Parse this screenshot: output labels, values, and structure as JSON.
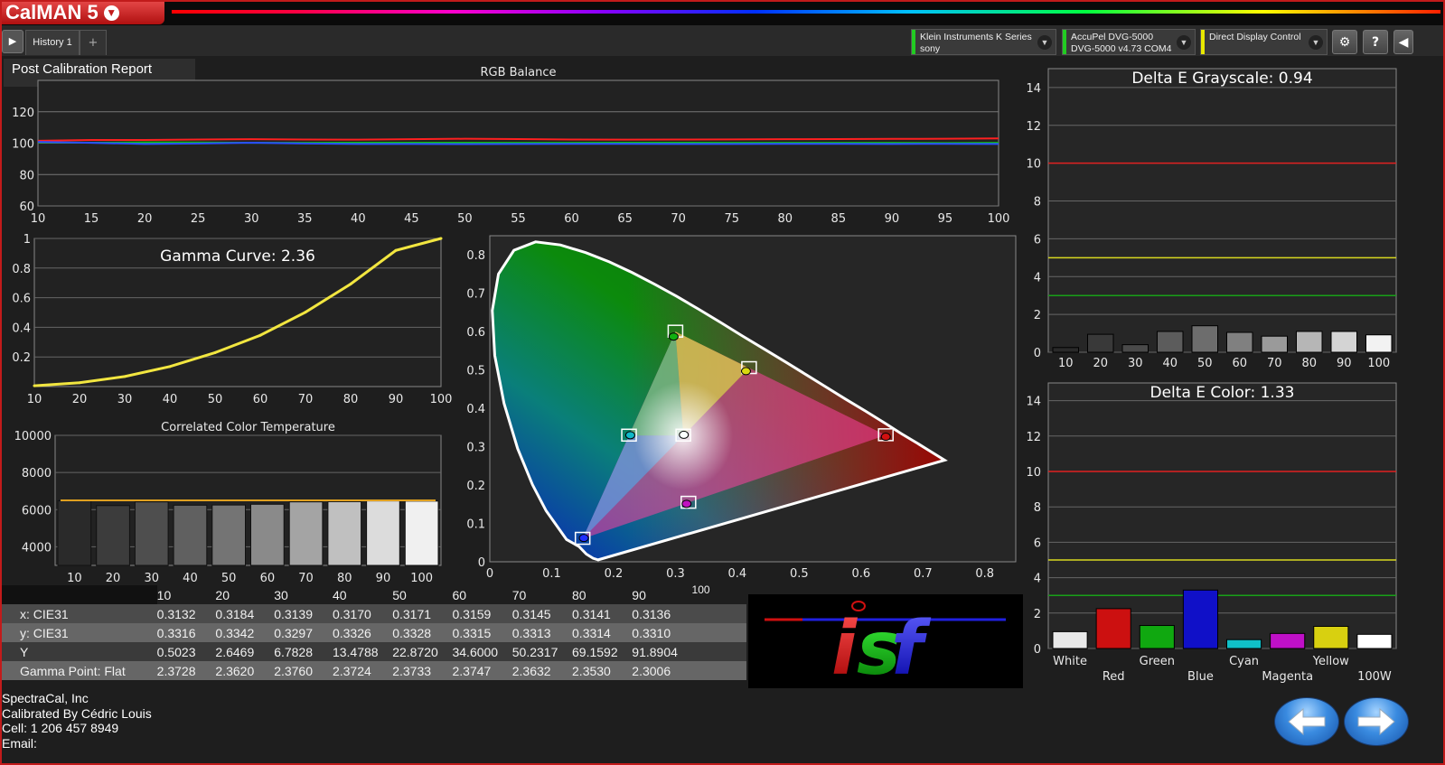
{
  "app": {
    "title": "CalMAN 5"
  },
  "tabs": [
    {
      "label": "History 1"
    },
    {
      "label": "+"
    }
  ],
  "devices": [
    {
      "line1": "Klein Instruments K Series",
      "line2": "sony",
      "stripe_color": "#22cc22"
    },
    {
      "line1": "AccuPel DVG-5000",
      "line2": "DVG-5000 v4.73 COM4",
      "stripe_color": "#22cc22"
    },
    {
      "line1": "Direct Display Control",
      "line2": "",
      "stripe_color": "#e8e800"
    }
  ],
  "toolbar": {
    "settings_icon": "gear-icon",
    "help_label": "?",
    "collapse_icon": "chevron-left-icon"
  },
  "report": {
    "title": "Post Calibration Report"
  },
  "rgb_balance": {
    "chart_data": {
      "type": "line",
      "title": "RGB Balance",
      "x": [
        10,
        15,
        20,
        25,
        30,
        35,
        40,
        45,
        50,
        55,
        60,
        65,
        70,
        75,
        80,
        85,
        90,
        95,
        100
      ],
      "ylim": [
        60,
        140
      ],
      "yticks": [
        60,
        80,
        100,
        120
      ],
      "series": [
        {
          "color": "#ff2020",
          "values": [
            101.5,
            102,
            102,
            102.3,
            102.5,
            102.3,
            102.2,
            102.5,
            102.8,
            102.6,
            102.3,
            102.2,
            102.3,
            102.4,
            102.5,
            102.6,
            102.7,
            102.8,
            103
          ]
        },
        {
          "color": "#10c010",
          "values": [
            100.5,
            100.3,
            100.5,
            100.4,
            100.2,
            100.2,
            100.3,
            100.3,
            100.3,
            100.2,
            100.2,
            100.3,
            100.3,
            100.2,
            100.2,
            100.2,
            100.2,
            100.1,
            100.2
          ]
        },
        {
          "color": "#2a4cff",
          "values": [
            100.8,
            100.2,
            99.5,
            99.8,
            100.3,
            99.8,
            99.5,
            99.5,
            99.4,
            99.5,
            99.6,
            99.6,
            99.5,
            99.5,
            99.6,
            99.6,
            99.5,
            99.6,
            99.5
          ]
        }
      ]
    }
  },
  "gamma": {
    "chart_data": {
      "type": "line",
      "title": "Gamma Curve: 2.36",
      "x": [
        10,
        20,
        30,
        40,
        50,
        60,
        70,
        80,
        90,
        100
      ],
      "xlim": [
        10,
        100
      ],
      "ylim": [
        0,
        1
      ],
      "yticks": [
        0.2,
        0.4,
        0.6,
        0.8,
        1
      ],
      "ytick_labels": [
        "0.2",
        "0.4",
        "0.6",
        "0.8",
        "1"
      ],
      "series": [
        {
          "color": "#f2e640",
          "values": [
            0.005,
            0.026,
            0.068,
            0.135,
            0.229,
            0.346,
            0.502,
            0.692,
            0.919,
            1.0
          ]
        }
      ]
    }
  },
  "cct": {
    "chart_data": {
      "type": "bar",
      "title": "Correlated Color Temperature",
      "categories": [
        "10",
        "20",
        "30",
        "40",
        "50",
        "60",
        "70",
        "80",
        "90",
        "100"
      ],
      "values": [
        6480,
        6220,
        6420,
        6240,
        6250,
        6290,
        6420,
        6430,
        6470,
        6460
      ],
      "target": 6500,
      "ylim": [
        3000,
        10000
      ],
      "yticks": [
        4000,
        6000,
        8000,
        10000
      ]
    }
  },
  "cie": {
    "chart_data": {
      "type": "scatter",
      "xlim": [
        0,
        0.85
      ],
      "ylim": [
        0,
        0.85
      ],
      "xticks": [
        0,
        0.1,
        0.2,
        0.3,
        0.4,
        0.5,
        0.6,
        0.7,
        0.8
      ],
      "xtick_labels": [
        "0",
        "0.1",
        "0.2",
        "0.3",
        "0.4",
        "0.5",
        "0.6",
        "0.7",
        "0.8"
      ],
      "yticks": [
        0,
        0.1,
        0.2,
        0.3,
        0.4,
        0.5,
        0.6,
        0.7,
        0.8
      ],
      "ytick_labels": [
        "0",
        "0.1",
        "0.2",
        "0.3",
        "0.4",
        "0.5",
        "0.6",
        "0.7",
        "0.8"
      ],
      "targets": [
        {
          "x": 0.64,
          "y": 0.33
        },
        {
          "x": 0.3,
          "y": 0.6
        },
        {
          "x": 0.15,
          "y": 0.06
        },
        {
          "x": 0.225,
          "y": 0.329
        },
        {
          "x": 0.321,
          "y": 0.154
        },
        {
          "x": 0.419,
          "y": 0.505
        },
        {
          "x": 0.3127,
          "y": 0.329
        }
      ],
      "measured": [
        {
          "x": 0.64,
          "y": 0.326,
          "color": "#d01010"
        },
        {
          "x": 0.297,
          "y": 0.587,
          "color": "#10b010"
        },
        {
          "x": 0.152,
          "y": 0.062,
          "color": "#2030ff"
        },
        {
          "x": 0.227,
          "y": 0.33,
          "color": "#10b8c8"
        },
        {
          "x": 0.318,
          "y": 0.151,
          "color": "#c010c0"
        },
        {
          "x": 0.414,
          "y": 0.497,
          "color": "#d8d810"
        },
        {
          "x": 0.3136,
          "y": 0.331,
          "color": "#ffffff"
        }
      ]
    }
  },
  "delta_e_grayscale": {
    "chart_data": {
      "type": "bar",
      "title": "Delta E Grayscale: 0.94",
      "categories": [
        "10",
        "20",
        "30",
        "40",
        "50",
        "60",
        "70",
        "80",
        "90",
        "100"
      ],
      "values": [
        0.25,
        0.95,
        0.4,
        1.1,
        1.4,
        1.05,
        0.85,
        1.1,
        1.1,
        0.92
      ],
      "bar_colors": [
        "#2a2a2a",
        "#393939",
        "#4a4a4a",
        "#5c5c5c",
        "#6d6d6d",
        "#808080",
        "#9a9a9a",
        "#b6b6b6",
        "#d4d4d4",
        "#f2f2f2"
      ],
      "thresholds": [
        {
          "value": 10,
          "color": "#e02020"
        },
        {
          "value": 5,
          "color": "#d8d820"
        },
        {
          "value": 3,
          "color": "#18a018"
        }
      ],
      "ylim": [
        0,
        15
      ],
      "yticks": [
        0,
        2,
        4,
        6,
        8,
        10,
        12,
        14
      ]
    }
  },
  "delta_e_color": {
    "chart_data": {
      "type": "bar",
      "title": "Delta E Color: 1.33",
      "categories": [
        "White",
        "Red",
        "Green",
        "Blue",
        "Cyan",
        "Magenta",
        "Yellow",
        "100W"
      ],
      "values": [
        0.95,
        2.25,
        1.3,
        3.3,
        0.5,
        0.85,
        1.25,
        0.8
      ],
      "bar_colors": [
        "#e8e8e8",
        "#cc1010",
        "#10a810",
        "#1010c8",
        "#10c0c8",
        "#c010c8",
        "#d8d010",
        "#ffffff"
      ],
      "thresholds": [
        {
          "value": 10,
          "color": "#e02020"
        },
        {
          "value": 5,
          "color": "#d8d820"
        },
        {
          "value": 3,
          "color": "#18a018"
        }
      ],
      "ylim": [
        0,
        15
      ],
      "yticks": [
        0,
        2,
        4,
        6,
        8,
        10,
        12,
        14
      ]
    }
  },
  "data_table": {
    "header": [
      "",
      "10",
      "20",
      "30",
      "40",
      "50",
      "60",
      "70",
      "80",
      "90",
      "100"
    ],
    "rows": [
      {
        "label": "x: CIE31",
        "values": [
          "0.3132",
          "0.3184",
          "0.3139",
          "0.3170",
          "0.3171",
          "0.3159",
          "0.3145",
          "0.3141",
          "0.3136"
        ]
      },
      {
        "label": "y: CIE31",
        "values": [
          "0.3316",
          "0.3342",
          "0.3297",
          "0.3326",
          "0.3328",
          "0.3315",
          "0.3313",
          "0.3314",
          "0.3310"
        ]
      },
      {
        "label": "Y",
        "values": [
          "0.5023",
          "2.6469",
          "6.7828",
          "13.4788",
          "22.8720",
          "34.6000",
          "50.2317",
          "69.1592",
          "91.8904"
        ]
      },
      {
        "label": "Gamma Point: Flat",
        "values": [
          "2.3728",
          "2.3620",
          "2.3760",
          "2.3724",
          "2.3733",
          "2.3747",
          "2.3632",
          "2.3530",
          "2.3006"
        ]
      }
    ]
  },
  "isf_logo": {
    "text": "isf"
  },
  "footer": {
    "company": "SpectraCal, Inc",
    "calibrated_by": "Calibrated By  Cédric Louis",
    "cell": "Cell: 1 206 457 8949",
    "email": "Email:"
  },
  "nav": {
    "back_icon": "arrow-left-icon",
    "forward_icon": "arrow-right-icon"
  }
}
